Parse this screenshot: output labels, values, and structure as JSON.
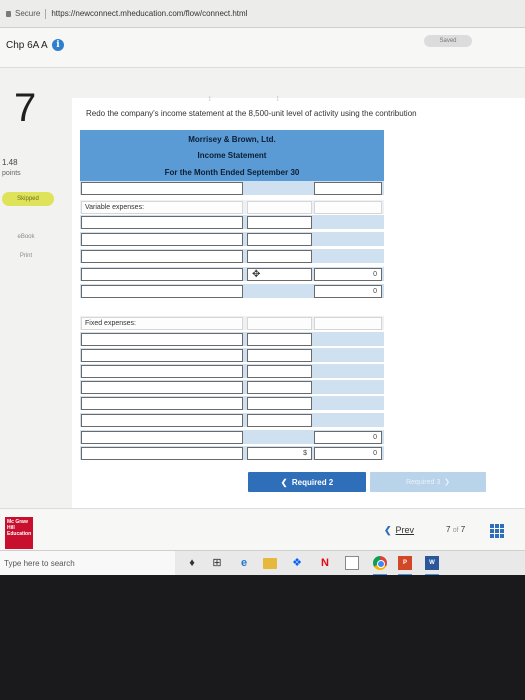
{
  "browser": {
    "secure_label": "Secure",
    "url": "https://newconnect.mheducation.com/flow/connect.html"
  },
  "header": {
    "title": "Chp 6A A",
    "info_icon": "info-icon",
    "saved_label": "Saved"
  },
  "sidebar": {
    "question_number": "7",
    "points_value": "1.48",
    "points_label": "points",
    "skipped_label": "Skipped",
    "ebook_label": "eBook",
    "print_label": "Print"
  },
  "question": {
    "instructions": "Redo the company's income statement at the 8,500-unit level of activity using the contribution"
  },
  "statement": {
    "company": "Morrisey & Brown, Ltd.",
    "title": "Income Statement",
    "period": "For the Month Ended September 30",
    "variable_label": "Variable expenses:",
    "fixed_label": "Fixed expenses:",
    "zero": "0",
    "dollar": "$"
  },
  "navigation": {
    "required2_label": "Required 2",
    "required3_label": "Required 3",
    "prev_label": "Prev",
    "page_current": "7",
    "page_of": "of",
    "page_total": "7"
  },
  "publisher": {
    "logo_text": "Mc Graw Hill Education"
  },
  "taskbar": {
    "search_placeholder": "Type here to search"
  },
  "colors": {
    "header_blue": "#5b9bd5",
    "row_blue": "#cfe0f1",
    "button_blue": "#2f6fba",
    "skipped_yellow": "#dfe35a"
  }
}
